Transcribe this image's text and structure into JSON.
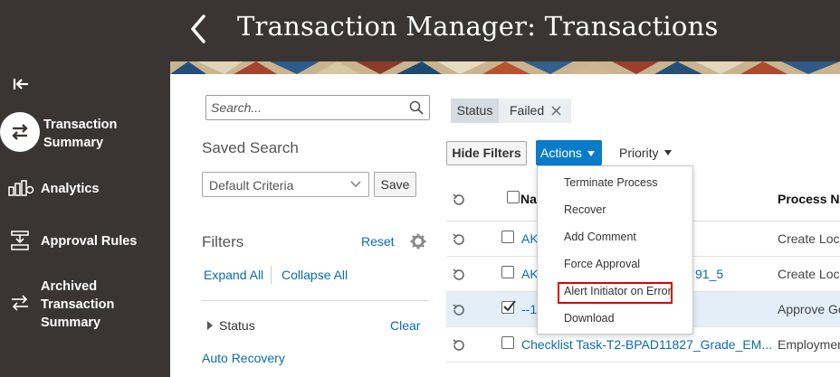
{
  "header": {
    "title": "Transaction Manager: Transactions"
  },
  "sidebar": {
    "items": [
      {
        "label_lines": [
          "Transaction",
          "Summary"
        ],
        "icon": "swap-arrows-icon",
        "active": true
      },
      {
        "label_lines": [
          "Analytics"
        ],
        "icon": "analytics-chart-icon"
      },
      {
        "label_lines": [
          "Approval Rules"
        ],
        "icon": "approval-rules-icon"
      },
      {
        "label_lines": [
          "Archived",
          "Transaction",
          "Summary"
        ],
        "icon": "archived-summary-icon"
      }
    ]
  },
  "search": {
    "placeholder": "Search..."
  },
  "saved_search": {
    "title": "Saved Search",
    "selected": "Default Criteria",
    "save_label": "Save"
  },
  "filters": {
    "title": "Filters",
    "reset_label": "Reset",
    "expand_all": "Expand All",
    "collapse_all": "Collapse All",
    "status_label": "Status",
    "clear_label": "Clear",
    "auto_recovery": "Auto Recovery"
  },
  "chip": {
    "field": "Status",
    "value": "Failed"
  },
  "toolbar": {
    "hide_filters": "Hide Filters",
    "actions": "Actions",
    "priority": "Priority"
  },
  "table": {
    "columns": {
      "name": "Na",
      "process": "Process Na"
    },
    "rows": [
      {
        "name": "AK",
        "process": "Create Loca",
        "checked": false,
        "selected": false
      },
      {
        "name": "AK",
        "name_suffix": "91_5",
        "process": "Create Loca",
        "checked": false,
        "selected": false
      },
      {
        "name": "--1",
        "process": "Approve Go",
        "checked": true,
        "selected": true
      },
      {
        "name": "Checklist Task-T2-BPAD11827_Grade_EM...",
        "process": "Employmen",
        "checked": false,
        "selected": false
      }
    ]
  },
  "actions_menu": {
    "items": [
      "Terminate Process",
      "Recover",
      "Add Comment",
      "Force Approval",
      "Alert Initiator on Error",
      "Download"
    ],
    "highlighted": "Alert Initiator on Error",
    "highlight_color": "#e00000"
  },
  "colors": {
    "header_bg": "#3a3533",
    "accent": "#0a7bcb",
    "link": "#0a6cac"
  }
}
